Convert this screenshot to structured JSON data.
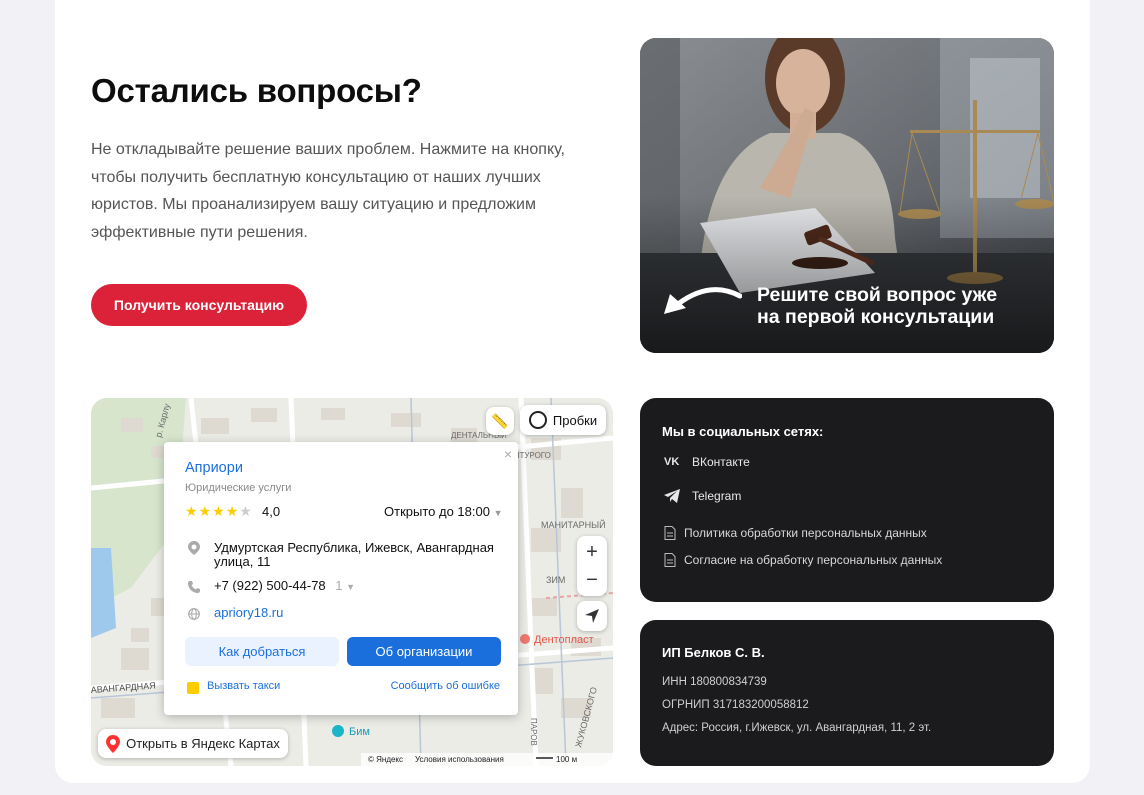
{
  "cta_section": {
    "title": "Остались вопросы?",
    "description": "Не откладывайте решение ваших проблем. Нажмите на кнопку, чтобы получить бесплатную консультацию от наших лучших юристов. Мы проанализируем вашу ситуацию и предложим эффективные пути решения.",
    "button_label": "Получить консультацию"
  },
  "hero": {
    "caption_line1": "Решите свой вопрос уже",
    "caption_line2": "на первой консультации"
  },
  "map": {
    "traffic_label": "Пробки",
    "open_in_yandex_label": "Открыть в Яндекс Картах",
    "copyright": "© Яндекс",
    "terms": "Условия использования",
    "scale": "100 м",
    "street_labels": [
      "р. Карлу",
      "ДЕНТАЛЬНЫЙ",
      "ШЕНТУРОГО",
      "МАНИТАРНЫЙ",
      "ЗИМ",
      "АВАНГАРДНАЯ",
      "ПАРОВ",
      "ЖУКОВСКОГО"
    ],
    "poi_dentoplast": "Дентопласт",
    "poi_bim": "Бим",
    "card": {
      "name": "Априори",
      "category": "Юридические услуги",
      "rating": "4,0",
      "open_status": "Открыто до 18:00",
      "address": "Удмуртская Республика, Ижевск, Авангардная улица, 11",
      "phone": "+7 (922) 500-44-78",
      "phone_extra": "1",
      "website": "apriory18.ru",
      "route_button": "Как добраться",
      "org_button": "Об организации",
      "taxi_link": "Вызвать такси",
      "report_link": "Сообщить об ошибке"
    }
  },
  "social": {
    "heading": "Мы в социальных сетях:",
    "links": [
      "ВКонтакте",
      "Telegram"
    ],
    "docs": [
      "Политика обработки персональных данных",
      "Согласие на обработку персональных данных"
    ]
  },
  "company": {
    "name": "ИП Белков С. В.",
    "inn": "ИНН 180800834739",
    "ogrnip": "ОГРНИП 317183200058812",
    "address": "Адрес: Россия, г.Ижевск, ул. Авангардная, 11, 2 эт."
  },
  "colors": {
    "accent": "#dc2239",
    "link": "#1a6fdc",
    "dark_card": "#1b1b1d"
  }
}
